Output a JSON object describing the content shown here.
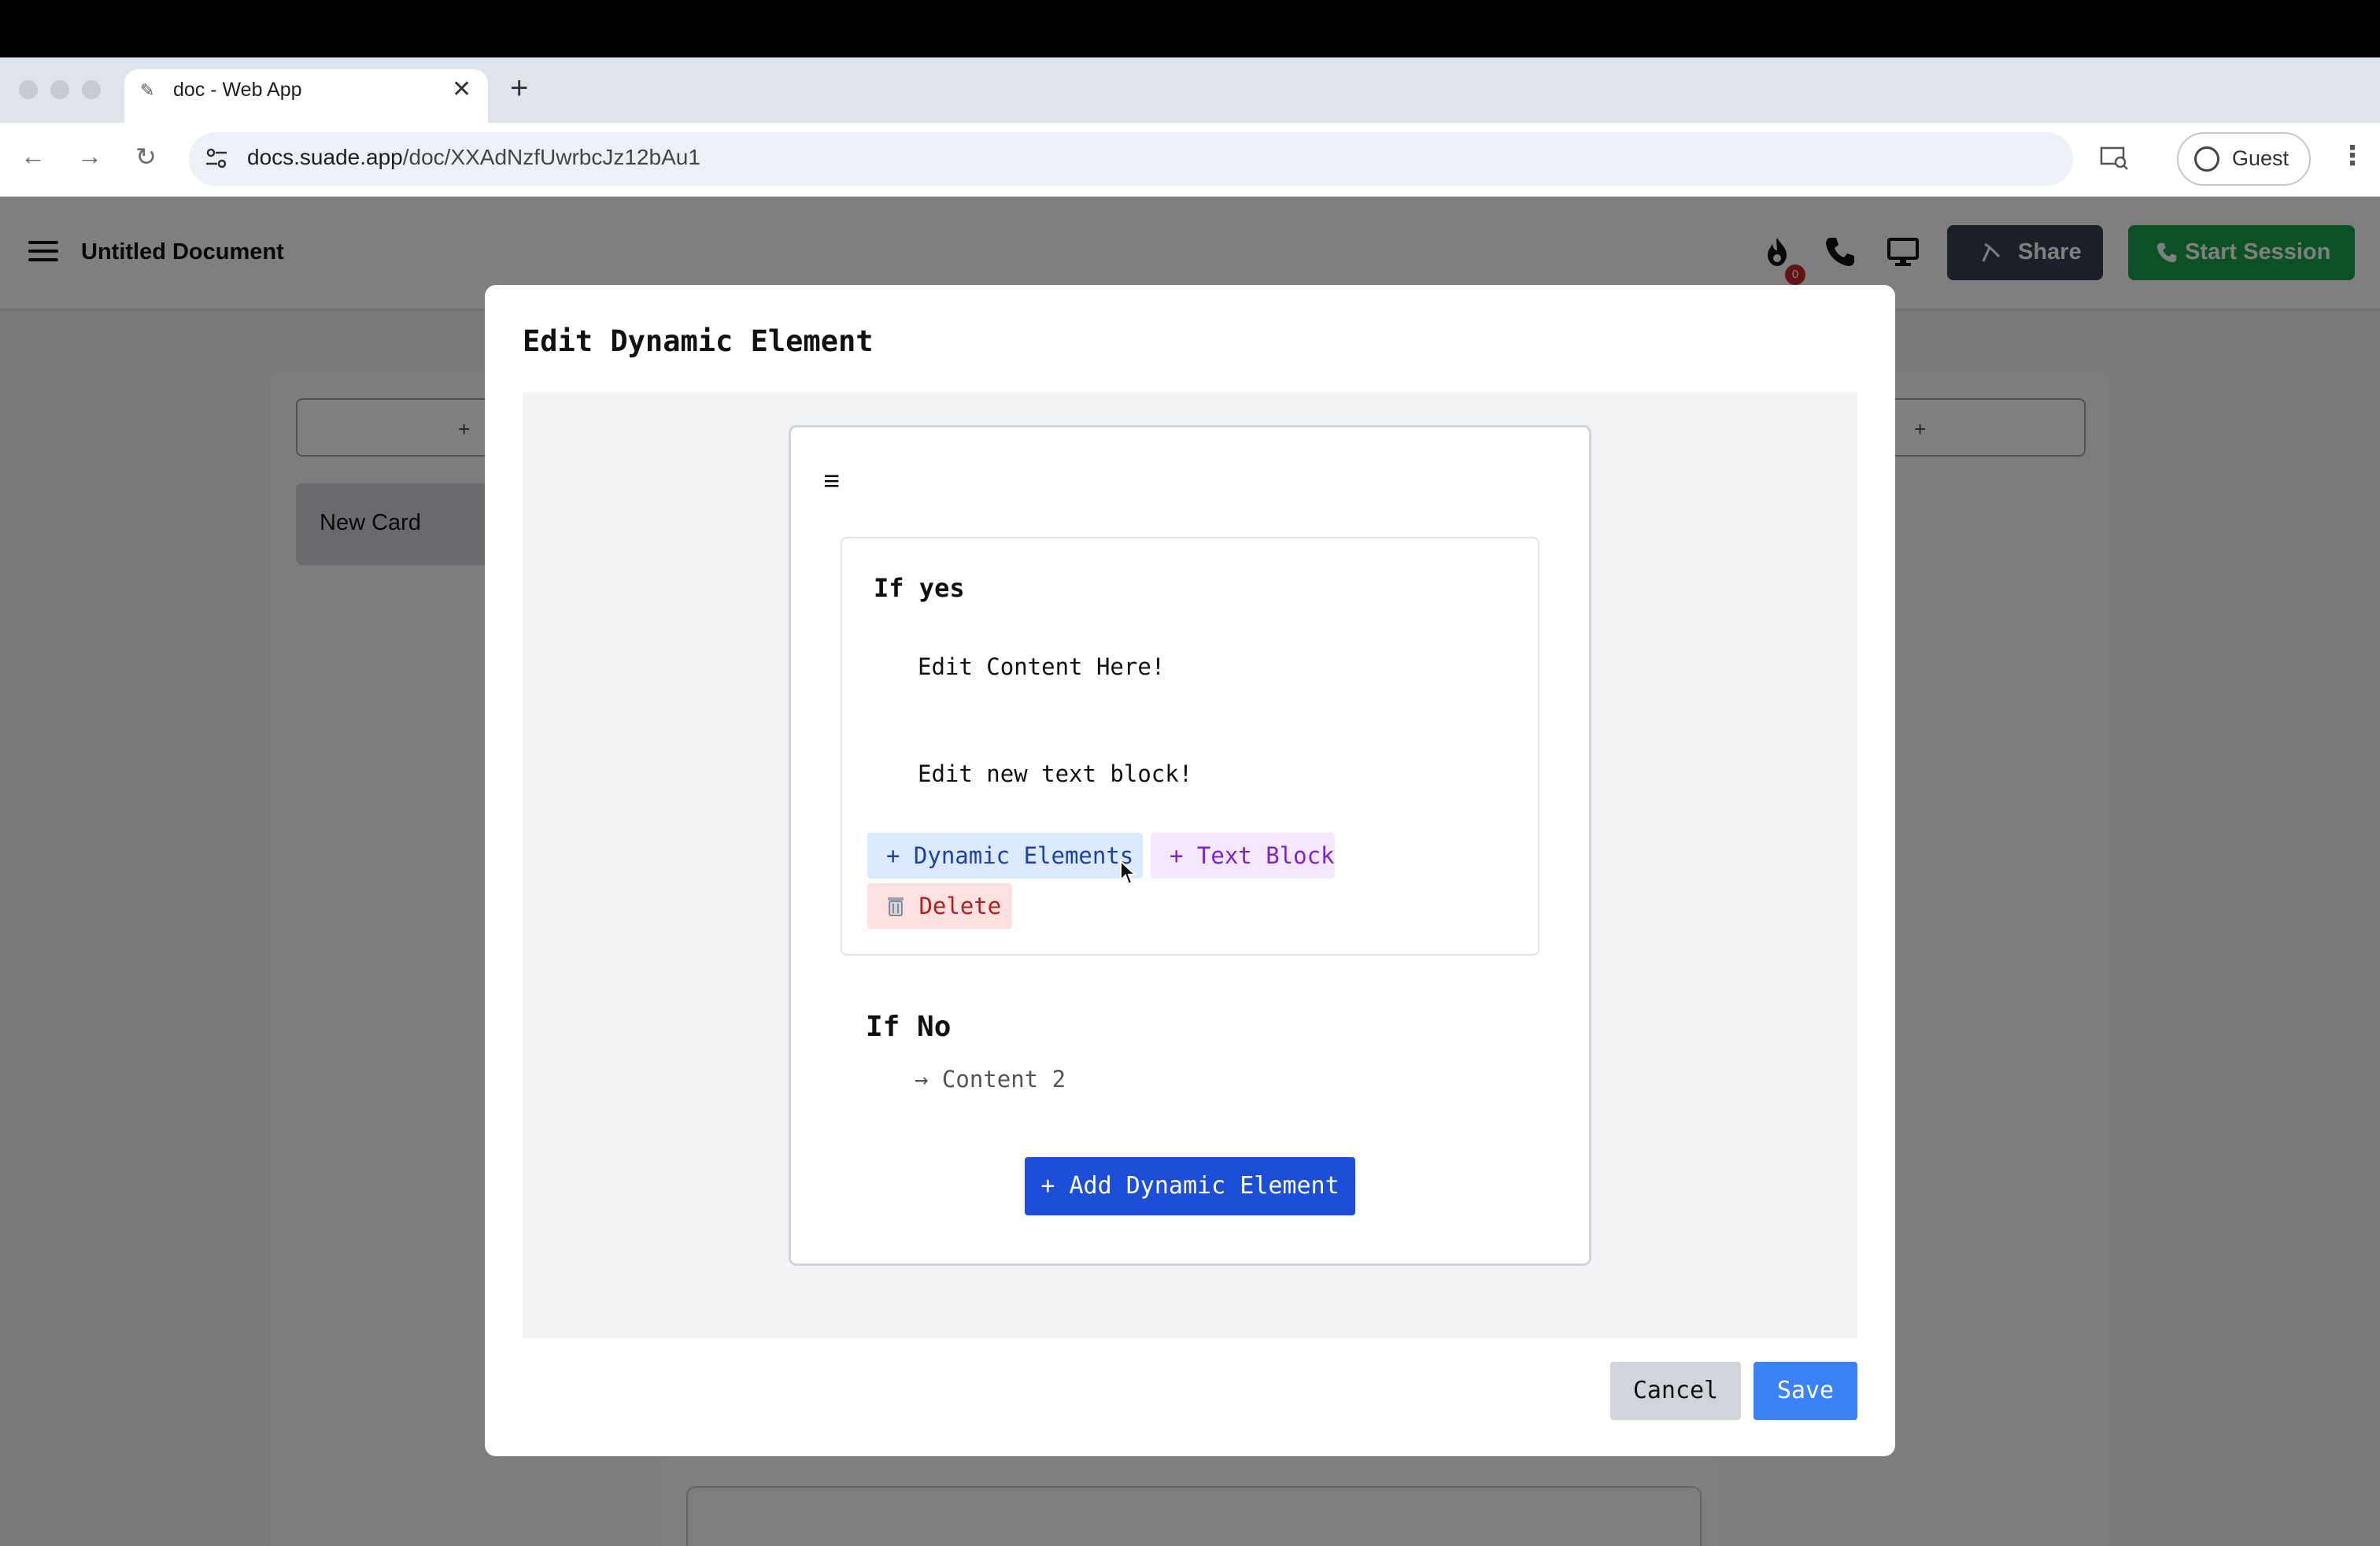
{
  "browser": {
    "tab_title": "doc - Web App",
    "new_tab_symbol": "+",
    "close_symbol": "✕",
    "url_host": "docs.suade.app",
    "url_path": "/doc/XXAdNzfUwrbcJz12bAu1",
    "profile_label": "Guest",
    "menu_symbol": "⋮"
  },
  "header": {
    "doc_title": "Untitled Document",
    "notification_count": "0",
    "share_label": "Share",
    "start_session_label": "Start Session"
  },
  "board": {
    "add_column_symbol": "+",
    "card_title": "New Card"
  },
  "modal": {
    "title": "Edit Dynamic Element",
    "menu_symbol": "≡",
    "yes_branch": {
      "title": "If yes",
      "blocks": [
        "Edit Content Here!",
        "Edit new text block!"
      ],
      "add_dynamic_label": "+ Dynamic Elements",
      "add_text_label": "+ Text Block",
      "delete_label": "Delete"
    },
    "no_branch": {
      "title": "If No",
      "content": "→ Content 2"
    },
    "add_dynamic_element_label": "+ Add Dynamic Element",
    "cancel_label": "Cancel",
    "save_label": "Save"
  },
  "colors": {
    "primary": "#1d4ed8",
    "save": "#3b82f6",
    "session": "#16a34a",
    "share": "#374151",
    "delete_bg": "#fee2e2",
    "text_block_bg": "#f3e8ff",
    "dynamic_bg": "#dbeafe"
  },
  "icons": {
    "fire": "fire-icon",
    "phone": "phone-icon",
    "monitor": "monitor-icon",
    "trash": "trash-icon"
  }
}
